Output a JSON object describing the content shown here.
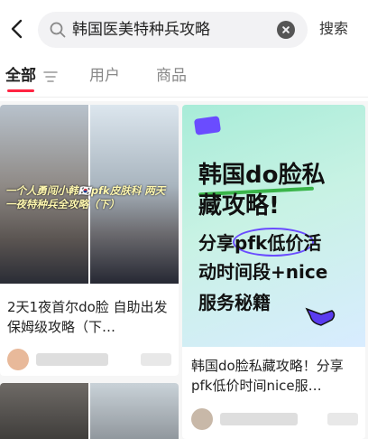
{
  "search": {
    "query": "韩国医美特种兵攻略",
    "submit_label": "搜索"
  },
  "tabs": [
    {
      "label": "全部",
      "active": true
    },
    {
      "label": "用户",
      "active": false
    },
    {
      "label": "商品",
      "active": false
    }
  ],
  "colors": {
    "accent": "#ff2442"
  },
  "feed": {
    "cards": [
      {
        "title": "2天1夜首尔do脸 自助出发保姆级攻略（下…",
        "overlay_text": "一个人勇闯小韩🇰🇷pfk皮肤科 两天一夜特种兵全攻略（下）"
      },
      {
        "title": "韩国do脸私藏攻略！分享pfk低价时间nice服…",
        "poster_lines": [
          "韩国do脸私",
          "藏攻略!",
          "分享pfk低价活",
          "动时间段+nice",
          "服务秘籍"
        ]
      }
    ]
  },
  "icons": {
    "back": "chevron-left-icon",
    "search": "search-icon",
    "clear": "clear-icon",
    "filter": "filter-icon"
  }
}
